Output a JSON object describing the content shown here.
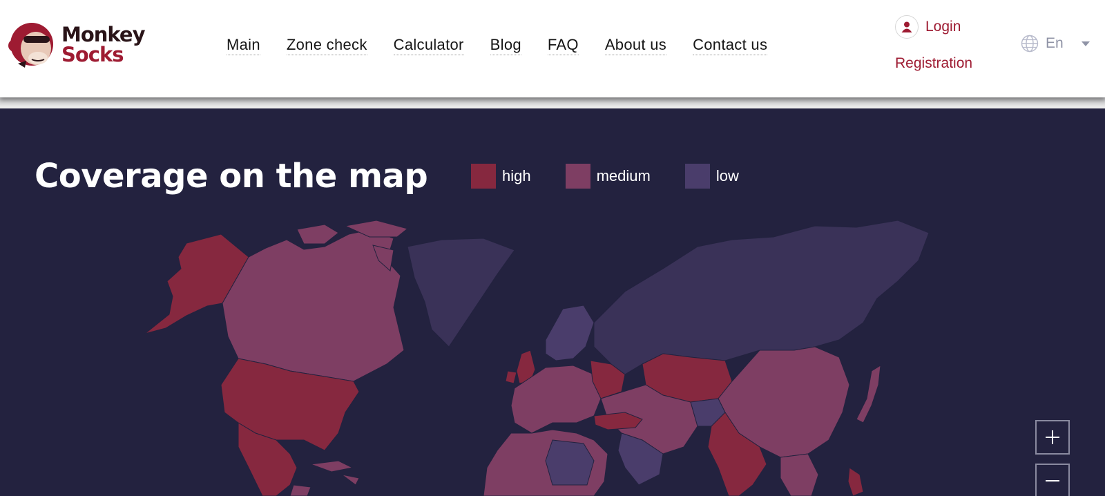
{
  "brand": {
    "line1": "Monkey",
    "line2": "Socks"
  },
  "nav": {
    "items": [
      {
        "label": "Main"
      },
      {
        "label": "Zone check"
      },
      {
        "label": "Calculator"
      },
      {
        "label": "Blog"
      },
      {
        "label": "FAQ"
      },
      {
        "label": "About us"
      },
      {
        "label": "Contact us"
      }
    ]
  },
  "auth": {
    "login_label": "Login",
    "register_label": "Registration"
  },
  "language": {
    "selected": "En",
    "icon": "globe-icon"
  },
  "map": {
    "title": "Coverage on the map",
    "legend": [
      {
        "label": "high",
        "color": "#86283f"
      },
      {
        "label": "medium",
        "color": "#7e3e63"
      },
      {
        "label": "low",
        "color": "#4a3d6b"
      }
    ],
    "zoom_in_icon": "plus-icon",
    "zoom_out_icon": "minus-icon"
  },
  "colors": {
    "accent": "#9e1b32",
    "background": "#23223f",
    "high": "#86283f",
    "medium": "#7e3e63",
    "low": "#4a3d6b"
  }
}
